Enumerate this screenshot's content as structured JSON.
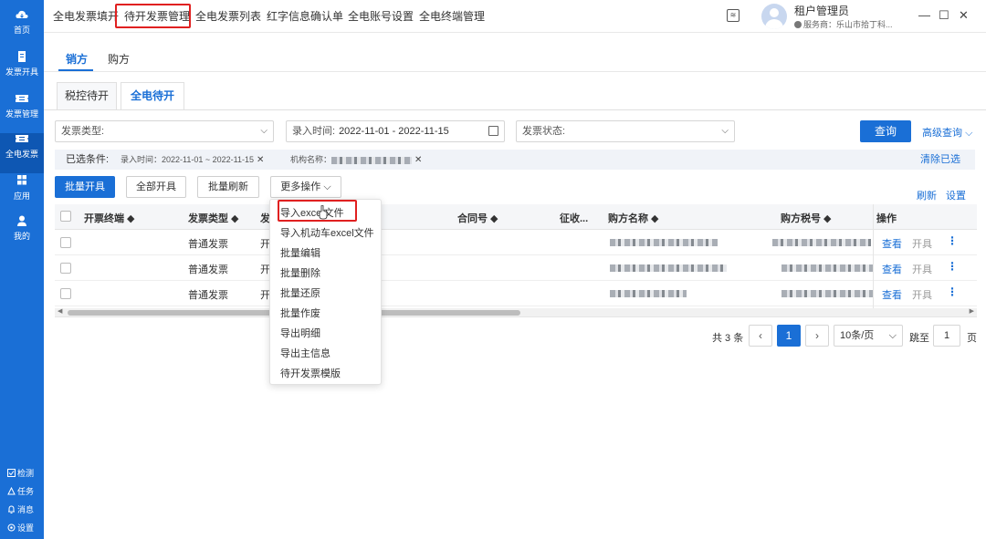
{
  "sidebar": {
    "items": [
      {
        "label": "首页",
        "icon": "home-cloud-icon"
      },
      {
        "label": "发票开具",
        "icon": "invoice-issue-icon"
      },
      {
        "label": "发票管理",
        "icon": "ticket-icon"
      },
      {
        "label": "全电发票",
        "icon": "ticket-icon"
      },
      {
        "label": "应用",
        "icon": "apps-grid-icon"
      },
      {
        "label": "我的",
        "icon": "user-icon"
      }
    ],
    "bottom": [
      {
        "label": "检测",
        "icon": "check-icon"
      },
      {
        "label": "任务",
        "icon": "task-icon"
      },
      {
        "label": "消息",
        "icon": "bell-icon"
      },
      {
        "label": "设置",
        "icon": "gear-icon"
      }
    ]
  },
  "topnav": {
    "items": [
      "全电发票填开",
      "待开发票管理",
      "全电发票列表",
      "红字信息确认单",
      "全电账号设置",
      "全电终端管理"
    ],
    "active_index": 1,
    "msg_icon": "≋"
  },
  "user": {
    "name": "租户管理员",
    "service_label": "服务商：乐山市拾丁科..."
  },
  "window": {
    "minimize": "—",
    "maximize": "☐",
    "close": "✕"
  },
  "role_tabs": [
    "销方",
    "购方"
  ],
  "sub_tabs": [
    "税控待开",
    "全电待开"
  ],
  "filters": {
    "invoice_type": "发票类型:",
    "entry_time_label": "录入时间:",
    "entry_time_value": "2022-11-01 - 2022-11-15",
    "invoice_status": "发票状态:",
    "query_button": "查询",
    "advanced_query": "高级查询"
  },
  "conditions": {
    "label": "已选条件:",
    "tags": [
      "录入时间：2022-11-01 ~ 2022-11-15",
      "机构名称："
    ],
    "clear": "清除已选"
  },
  "actions": {
    "batch_issue": "批量开具",
    "issue_all": "全部开具",
    "batch_refresh": "批量刷新",
    "more_actions": "更多操作",
    "refresh": "刷新",
    "settings": "设置"
  },
  "table": {
    "columns": [
      "开票终端",
      "发票类型",
      "发",
      "合同号",
      "征收...",
      "购方名称",
      "购方税号",
      "操作"
    ],
    "rows": [
      {
        "invoice_type": "普通发票",
        "col3": "开",
        "view": "查看",
        "issue": "开具"
      },
      {
        "invoice_type": "普通发票",
        "col3": "开",
        "view": "查看",
        "issue": "开具"
      },
      {
        "invoice_type": "普通发票",
        "col3": "开",
        "view": "查看",
        "issue": "开具"
      }
    ]
  },
  "pagination": {
    "total": "共 3 条",
    "current_page": "1",
    "page_size": "10条/页",
    "jump_label": "跳至",
    "jump_value": "1",
    "page_suffix": "页"
  },
  "more_menu": {
    "items": [
      "导入excel文件",
      "导入机动车excel文件",
      "批量编辑",
      "批量删除",
      "批量还原",
      "批量作废",
      "导出明细",
      "导出主信息",
      "待开发票模版"
    ]
  },
  "colors": {
    "primary": "#1a6fd6",
    "highlight": "#e02020",
    "sidebar": "#1a6fd6"
  }
}
